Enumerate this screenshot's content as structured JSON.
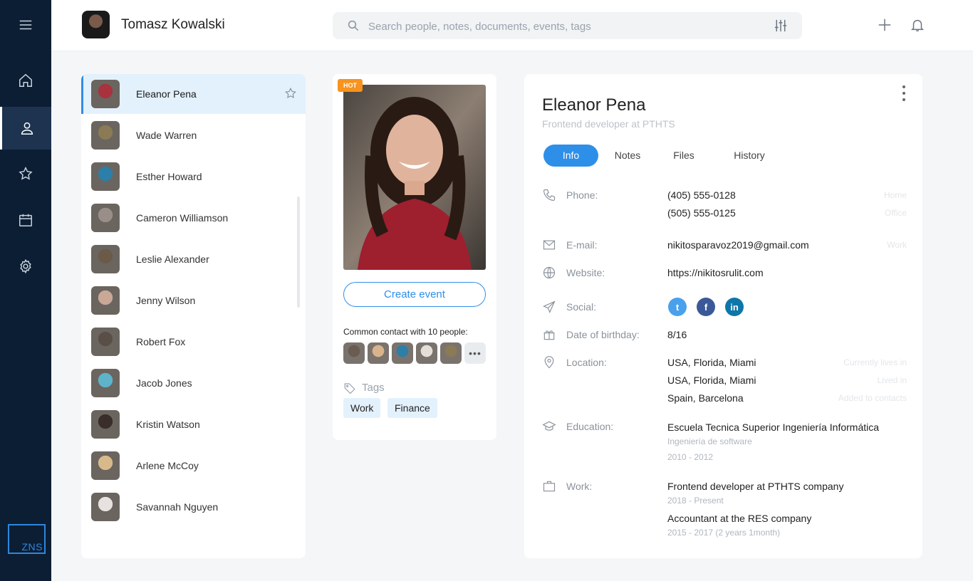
{
  "header": {
    "user_name": "Tomasz Kowalski",
    "search_placeholder": "Search people, notes, documents, events, tags",
    "icons": [
      "filter-icon",
      "plus-icon",
      "bell-icon"
    ]
  },
  "rail": {
    "items": [
      "home-icon",
      "contacts-icon",
      "star-icon",
      "calendar-icon",
      "settings-icon"
    ],
    "active": "contacts-icon",
    "logo": "ZNS"
  },
  "contacts": [
    {
      "name": "Eleanor Pena",
      "selected": true,
      "color": "#a8323e"
    },
    {
      "name": "Wade Warren",
      "color": "#8a7a55"
    },
    {
      "name": "Esther Howard",
      "color": "#2b7fa8"
    },
    {
      "name": "Cameron Williamson",
      "color": "#9a8f88"
    },
    {
      "name": "Leslie Alexander",
      "color": "#6b5a48"
    },
    {
      "name": "Jenny Wilson",
      "color": "#c9a898"
    },
    {
      "name": "Robert Fox",
      "color": "#5a4f47"
    },
    {
      "name": "Jacob Jones",
      "color": "#5fb3c9"
    },
    {
      "name": "Kristin Watson",
      "color": "#3a2e2a"
    },
    {
      "name": "Arlene McCoy",
      "color": "#d8b98a"
    },
    {
      "name": "Savannah Nguyen",
      "color": "#e6e2df"
    }
  ],
  "profile_card": {
    "badge": "HOT",
    "create_event": "Create event",
    "common_contacts": "Common contact with  10 people:",
    "common_avatars": [
      "#6a5c50",
      "#d9b38c",
      "#2b7fa8",
      "#e5ddd8",
      "#8a7a55"
    ],
    "more": "•••",
    "tags_label": "Tags",
    "tags": [
      "Work",
      "Finance"
    ]
  },
  "detail": {
    "name": "Eleanor Pena",
    "role": "Frontend developer at PTHTS",
    "tabs": [
      "Info",
      "Notes",
      "Files",
      "History"
    ],
    "active_tab": "Info",
    "phone_label": "Phone:",
    "phones": [
      "(405) 555-0128",
      "(505) 555-0125"
    ],
    "phone_notes": [
      "Home",
      "Office"
    ],
    "email_label": "E-mail:",
    "email": "nikitosparavoz2019@gmail.com",
    "email_note": "Work",
    "website_label": "Website:",
    "website": "https://nikitosrulit.com",
    "social_label": "Social:",
    "social": [
      {
        "icon": "twitter-icon",
        "color": "#4aa1eb",
        "glyph": "t"
      },
      {
        "icon": "facebook-icon",
        "color": "#3b5998",
        "glyph": "f"
      },
      {
        "icon": "linkedin-icon",
        "color": "#0e76a8",
        "glyph": "in"
      }
    ],
    "birthday_label": "Date of birthday:",
    "birthday": "8/16",
    "location_label": "Location:",
    "locations": [
      "USA, Florida, Miami",
      "USA, Florida, Miami",
      "Spain, Barcelona"
    ],
    "location_notes": [
      "Currently lives in",
      "Lived in",
      "Added to contacts"
    ],
    "education_label": "Education:",
    "education": "Escuela Tecnica Superior Ingeniería Informática",
    "education_sub": "Ingeniería de software",
    "education_years": "2010 - 2012",
    "work_label": "Work:",
    "work1": "Frontend developer at PTHTS company",
    "work1_years": "2018 - Present",
    "work2": "Accountant at the RES company",
    "work2_years": "2015 - 2017 (2 years 1month)"
  }
}
